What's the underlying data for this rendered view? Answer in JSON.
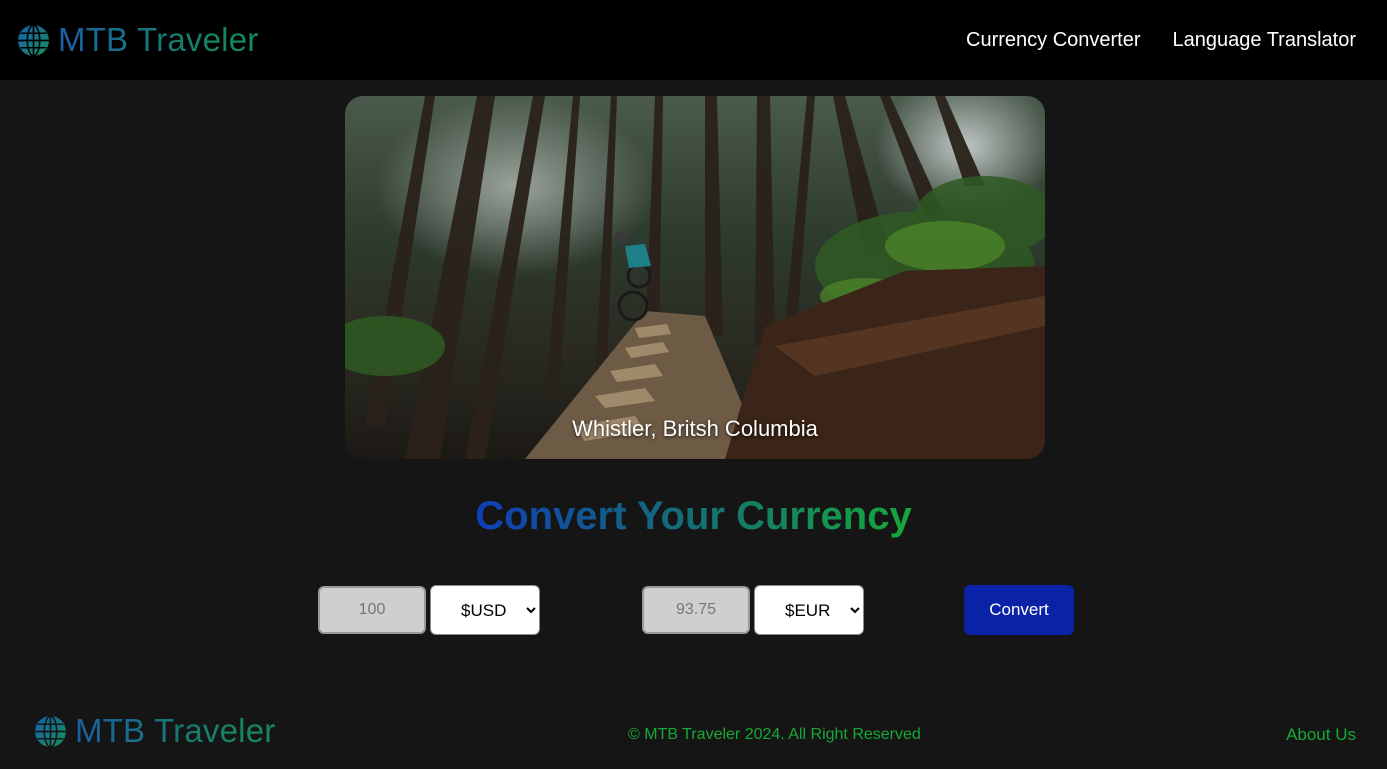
{
  "header": {
    "brand_name": "MTB Traveler",
    "brand_icon": "globe-icon",
    "nav": [
      {
        "label": "Currency Converter"
      },
      {
        "label": "Language Translator"
      }
    ]
  },
  "hero": {
    "image_subject": "mountain biker descending rocky forest trail",
    "caption": "Whistler, Britsh Columbia"
  },
  "converter": {
    "title": "Convert Your Currency",
    "from_amount": "100",
    "from_currency": "$USD",
    "to_amount": "93.75",
    "to_currency": "$EUR",
    "convert_label": "Convert"
  },
  "footer": {
    "brand_name": "MTB Traveler",
    "copyright": "© MTB Traveler 2024. All Right Reserved",
    "about_label": "About Us"
  },
  "colors": {
    "background": "#151515",
    "header": "#000000",
    "button": "#0a22a6",
    "footer_text": "#17a836",
    "title_start": "#0f3fb8",
    "title_end": "#17a83a"
  }
}
